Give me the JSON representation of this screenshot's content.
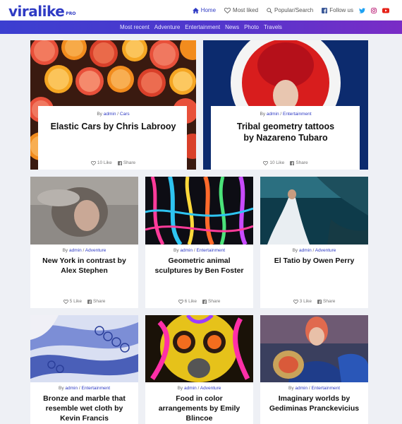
{
  "brand": {
    "name": "viralike",
    "badge": "PRO"
  },
  "topnav": {
    "home": "Home",
    "most_liked": "Most liked",
    "popular": "Popular/Search",
    "follow": "Follow us"
  },
  "categories": [
    "Most recent",
    "Adventure",
    "Entertainment",
    "News",
    "Photo",
    "Travels"
  ],
  "labels": {
    "by": "By",
    "like": "Like",
    "share": "Share",
    "sep": "/"
  },
  "colors": {
    "brand": "#2f3bc4",
    "bar_start": "#3b3fd0",
    "bar_end": "#7a2cc6"
  },
  "posts": [
    {
      "author": "admin",
      "category": "Cars",
      "title": "Elastic Cars by Chris Labrooy",
      "likes": "10",
      "image": "citrus-slices"
    },
    {
      "author": "admin",
      "category": "Entertainment",
      "title": "Tribal geometry tattoos by Nazareno Tubaro",
      "likes": "10",
      "image": "red-flower-headdress"
    },
    {
      "author": "admin",
      "category": "Adventure",
      "title": "New York in contrast by Alex Stephen",
      "likes": "5",
      "image": "blurred-portrait"
    },
    {
      "author": "admin",
      "category": "Entertainment",
      "title": "Geometric animal sculptures by Ben Foster",
      "likes": "6",
      "image": "paint-drips"
    },
    {
      "author": "admin",
      "category": "Adventure",
      "title": "El Tatio by Owen Perry",
      "likes": "3",
      "image": "underwater-dress"
    },
    {
      "author": "admin",
      "category": "Entertainment",
      "title": "Bronze and marble that resemble wet cloth by Kevin Francis",
      "likes": "",
      "image": "blue-lace-fabric"
    },
    {
      "author": "admin",
      "category": "Adventure",
      "title": "Food in color arrangements by Emily Blincoe",
      "likes": "",
      "image": "gas-mask-paint"
    },
    {
      "author": "admin",
      "category": "Entertainment",
      "title": "Imaginary worlds by Gediminas Pranckevicius",
      "likes": "",
      "image": "painted-portrait"
    }
  ]
}
